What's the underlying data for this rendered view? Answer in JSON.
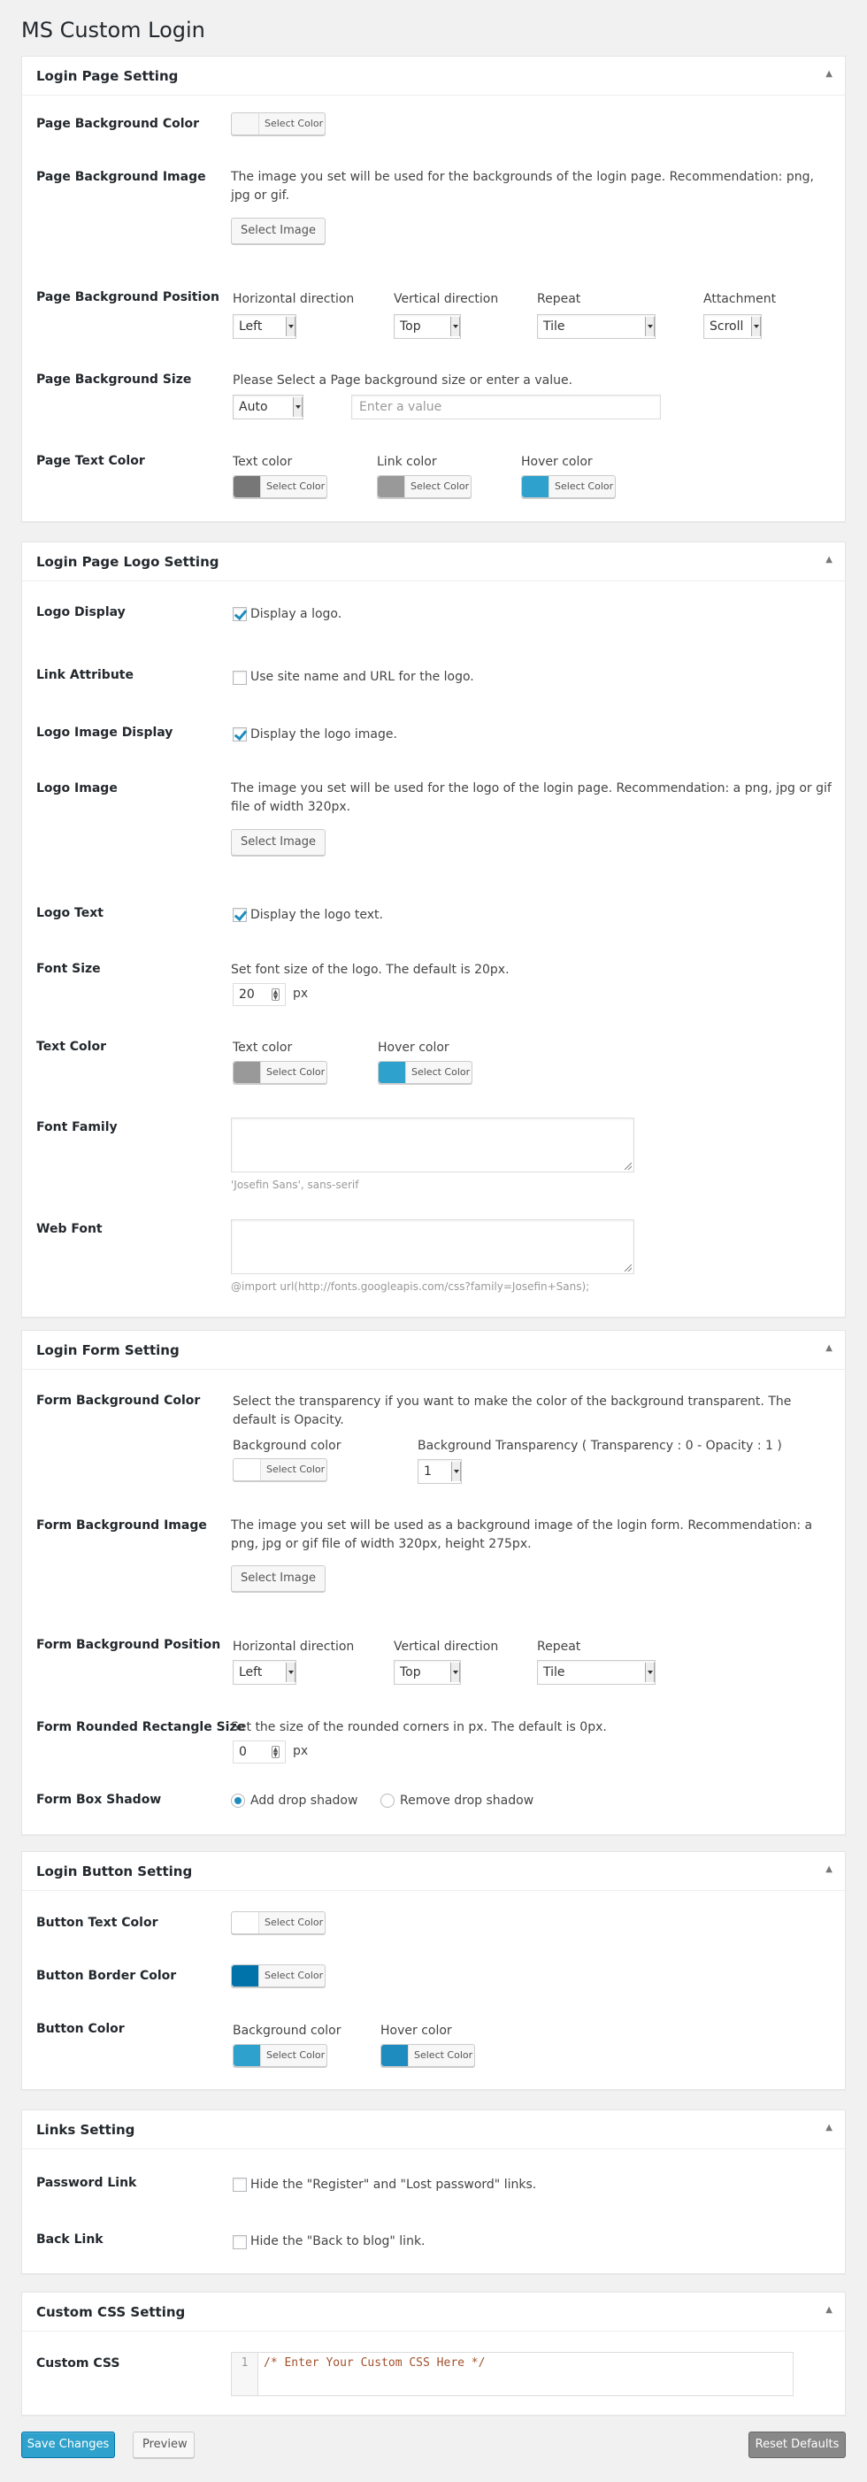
{
  "page": {
    "title": "MS Custom Login"
  },
  "labels": {
    "select_color": "Select Color",
    "select_image": "Select Image",
    "px": "px"
  },
  "colors": {
    "gray_dark": "#777777",
    "gray_light": "#999999",
    "blue": "#2ea2cc",
    "blue_dark": "#0073aa",
    "white": "#f7f7f7"
  },
  "login_page": {
    "title": "Login Page Setting",
    "bg_color_label": "Page Background Color",
    "bg_image_label": "Page Background Image",
    "bg_image_desc": "The image you set will be used for the backgrounds of the login page. Recommendation: png, jpg or gif.",
    "bg_position_label": "Page Background Position",
    "horizontal": "Horizontal direction",
    "horizontal_value": "Left",
    "vertical": "Vertical direction",
    "vertical_value": "Top",
    "repeat": "Repeat",
    "repeat_value": "Tile",
    "attachment": "Attachment",
    "attachment_value": "Scroll",
    "bg_size_label": "Page Background Size",
    "bg_size_desc": "Please Select a Page background size or enter a value.",
    "bg_size_value": "Auto",
    "bg_size_placeholder": "Enter a value",
    "text_color_label": "Page Text Color",
    "text_color": "Text color",
    "link_color": "Link color",
    "hover_color": "Hover color"
  },
  "logo": {
    "title": "Login Page Logo Setting",
    "display_label": "Logo Display",
    "display_text": "Display a logo.",
    "link_label": "Link Attribute",
    "link_text": "Use site name and URL for the logo.",
    "image_display_label": "Logo Image Display",
    "image_display_text": "Display the logo image.",
    "image_label": "Logo Image",
    "image_desc": "The image you set will be used for the logo of the login page. Recommendation: a png, jpg or gif file of width 320px.",
    "text_label": "Logo Text",
    "text_text": "Display the logo text.",
    "font_size_label": "Font Size",
    "font_size_desc": "Set font size of the logo. The default is 20px.",
    "font_size_value": "20",
    "text_color_label": "Text Color",
    "text_color": "Text color",
    "hover_color": "Hover color",
    "font_family_label": "Font Family",
    "font_family_hint": "'Josefin Sans', sans-serif",
    "web_font_label": "Web Font",
    "web_font_hint": "@import url(http://fonts.googleapis.com/css?family=Josefin+Sans);"
  },
  "form": {
    "title": "Login Form Setting",
    "bg_color_label": "Form Background Color",
    "bg_color_desc": "Select the transparency if you want to make the color of the background transparent. The default is Opacity.",
    "bg_color": "Background color",
    "transparency": "Background Transparency ( Transparency : 0 - Opacity : 1 )",
    "transparency_value": "1",
    "bg_image_label": "Form Background Image",
    "bg_image_desc": "The image you set will be used as a background image of the login form. Recommendation: a png, jpg or gif file of width 320px, height 275px.",
    "bg_position_label": "Form Background Position",
    "horizontal": "Horizontal direction",
    "horizontal_value": "Left",
    "vertical": "Vertical direction",
    "vertical_value": "Top",
    "repeat": "Repeat",
    "repeat_value": "Tile",
    "rounded_label": "Form Rounded Rectangle Size",
    "rounded_desc": "Set the size of the rounded corners in px. The default is 0px.",
    "rounded_value": "0",
    "shadow_label": "Form Box Shadow",
    "shadow_add": "Add drop shadow",
    "shadow_remove": "Remove drop shadow"
  },
  "button": {
    "title": "Login Button Setting",
    "text_color_label": "Button Text Color",
    "border_color_label": "Button Border Color",
    "color_label": "Button Color",
    "bg_color": "Background color",
    "hover_color": "Hover color"
  },
  "links": {
    "title": "Links Setting",
    "password_label": "Password Link",
    "password_text": "Hide the \"Register\" and \"Lost password\" links.",
    "back_label": "Back Link",
    "back_text": "Hide the \"Back to blog\" link."
  },
  "css": {
    "title": "Custom CSS Setting",
    "label": "Custom CSS",
    "line_no": "1",
    "code": "/* Enter Your Custom CSS Here */"
  },
  "footer": {
    "save": "Save Changes",
    "preview": "Preview",
    "reset": "Reset Defaults"
  }
}
